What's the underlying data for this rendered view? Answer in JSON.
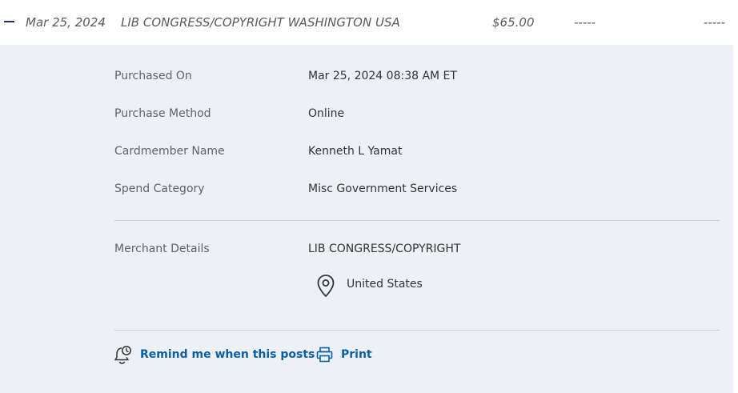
{
  "transaction": {
    "date": "Mar 25, 2024",
    "description": "LIB CONGRESS/COPYRIGHT WASHINGTON USA",
    "amount": "$65.00",
    "col_a": "-----",
    "col_b": "-----"
  },
  "details": [
    {
      "label": "Purchased On",
      "value": "Mar 25, 2024 08:38 AM ET"
    },
    {
      "label": "Purchase Method",
      "value": "Online"
    },
    {
      "label": "Cardmember Name",
      "value": "Kenneth L Yamat"
    },
    {
      "label": "Spend Category",
      "value": "Misc Government Services"
    }
  ],
  "merchant": {
    "label": "Merchant Details",
    "name": "LIB CONGRESS/COPYRIGHT",
    "location": "United States",
    "location_icon": "location-pin-icon"
  },
  "actions": {
    "remind_label": "Remind me when this posts",
    "remind_icon": "bell-clock-icon",
    "print_label": "Print",
    "print_icon": "printer-icon"
  },
  "colors": {
    "panel_bg": "#edf0f4",
    "link": "#0a5fa8",
    "collapse": "#1a2e6b"
  }
}
